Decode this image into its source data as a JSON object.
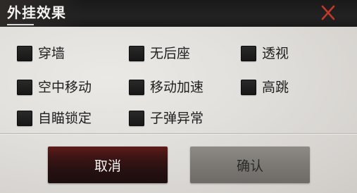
{
  "dialog": {
    "title": "外挂效果",
    "close_icon": "close-x-icon",
    "accent_color": "#c0392b"
  },
  "options": [
    {
      "label": "穿墙",
      "checked": false
    },
    {
      "label": "无后座",
      "checked": false
    },
    {
      "label": "透视",
      "checked": false
    },
    {
      "label": "空中移动",
      "checked": false
    },
    {
      "label": "移动加速",
      "checked": false
    },
    {
      "label": "高跳",
      "checked": false
    },
    {
      "label": "自瞄锁定",
      "checked": false
    },
    {
      "label": "子弹异常",
      "checked": false
    }
  ],
  "buttons": {
    "cancel_label": "取消",
    "confirm_label": "确认"
  }
}
